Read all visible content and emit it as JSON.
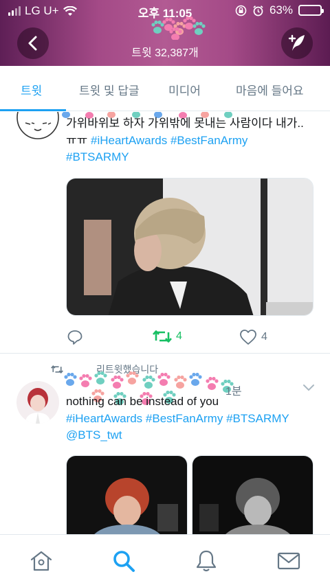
{
  "status_bar": {
    "carrier": "LG U+",
    "time": "오후 11:05",
    "battery": "63%",
    "battery_level": 0.63
  },
  "header": {
    "tweet_count": "트윗 32,387개"
  },
  "tabs": [
    {
      "label": "트윗",
      "active": true
    },
    {
      "label": "트윗 및 답글",
      "active": false
    },
    {
      "label": "미디어",
      "active": false
    },
    {
      "label": "마음에 들어요",
      "active": false
    }
  ],
  "tweet1": {
    "line1": "가위바위보 하자 가위밖에 못내는 사람이다 내가..",
    "line2_prefix": "ㅠㅠ",
    "hashtags": [
      "#iHeartAwards",
      "#BestFanArmy",
      "#BTSARMY"
    ],
    "retweets": "4",
    "likes": "4"
  },
  "tweet2": {
    "retweet_note": "리트윗했습니다",
    "time": "1분",
    "text": "nothing can be instead of you",
    "hashtags": [
      "#iHeartAwards",
      "#BestFanArmy",
      "#BTSARMY"
    ],
    "mention": "@BTS_twt"
  },
  "colors": {
    "accent": "#1da1f2",
    "retweet_green": "#17bf63",
    "header_purple": "#a44a87"
  },
  "icons": {
    "back": "chevron-left-icon",
    "compose": "feather-plus-icon",
    "reply": "reply-icon",
    "retweet": "retweet-icon",
    "like": "heart-icon",
    "home": "home-icon",
    "search": "search-icon",
    "notifications": "bell-icon",
    "messages": "mail-icon"
  }
}
